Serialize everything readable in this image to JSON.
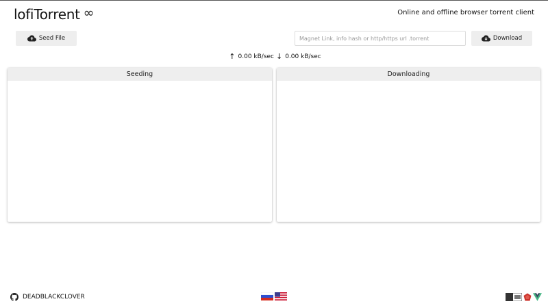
{
  "header": {
    "title": "lofiTorrent",
    "title_icon": "infinity-icon",
    "infinity_glyph": "∞",
    "tagline": "Online and offline browser torrent client"
  },
  "toolbar": {
    "seed_label": "Seed File",
    "seed_icon": "cloud-upload-icon",
    "magnet_placeholder": "Magnet Link, info hash or http/https url .torrent",
    "magnet_value": "",
    "download_label": "Download",
    "download_icon": "cloud-download-icon"
  },
  "speed": {
    "up_arrow": "↑",
    "upload": "0.00 kB/sec",
    "down_arrow": "↓",
    "download": "0.00 kB/sec"
  },
  "panels": {
    "seeding": {
      "title": "Seeding",
      "items": []
    },
    "downloading": {
      "title": "Downloading",
      "items": []
    }
  },
  "footer": {
    "author": "DEADBLACKCLOVER",
    "author_icon": "github-icon",
    "languages": [
      "russian-flag-icon",
      "us-flag-icon"
    ],
    "tech_icons": [
      "js-badge-icon",
      "ruby-icon",
      "vue-icon"
    ]
  },
  "colors": {
    "button_bg": "#eeeeee",
    "panel_header_bg": "#eeeeee",
    "vue_green": "#42b883",
    "ruby_red": "#cc342d"
  }
}
